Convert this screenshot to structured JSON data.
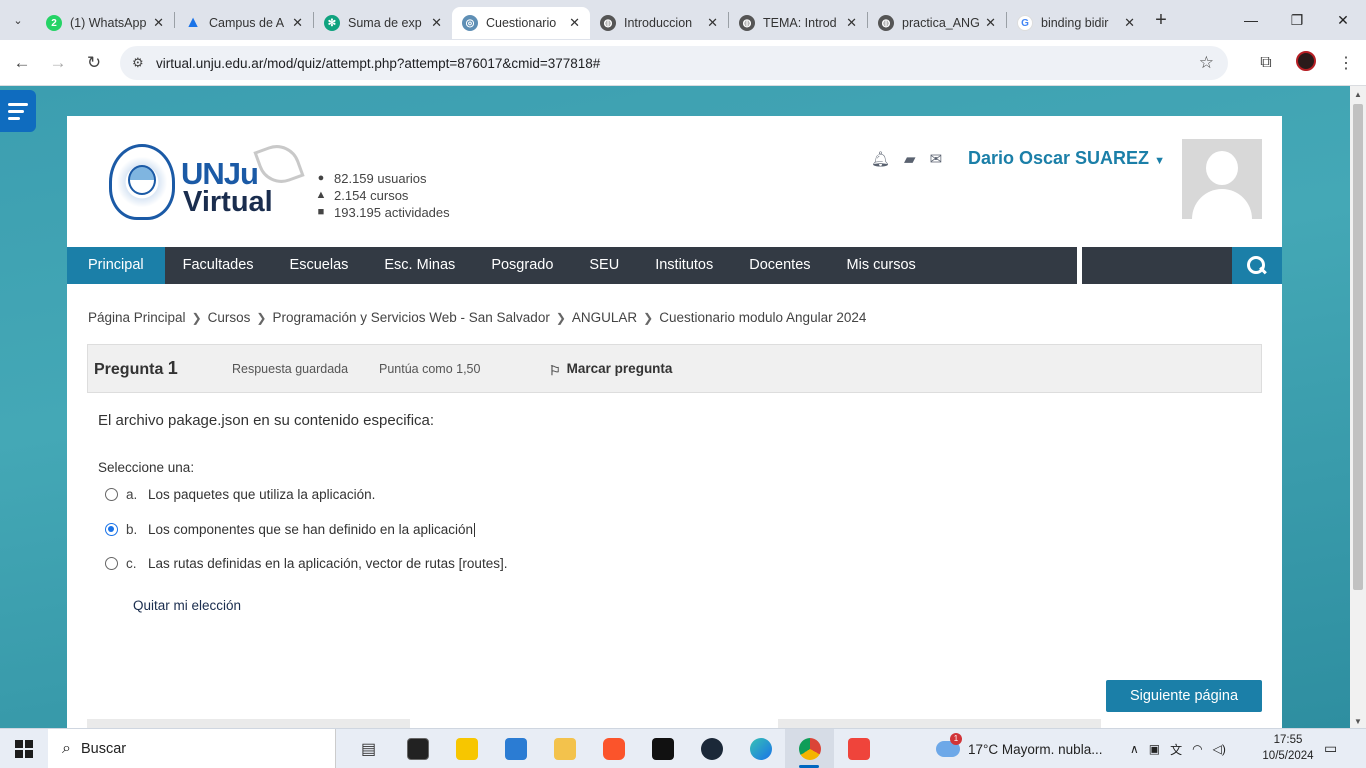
{
  "browser": {
    "tabs": [
      {
        "title": "(1) WhatsApp",
        "icon": "whatsapp-icon",
        "color": "#25d366",
        "active": false
      },
      {
        "title": "Campus de A",
        "icon": "campus-icon",
        "color": "#1a73e8",
        "active": false
      },
      {
        "title": "Suma de exp",
        "icon": "chatgpt-icon",
        "color": "#10a37f",
        "active": false
      },
      {
        "title": "Cuestionario",
        "icon": "moodle-icon",
        "color": "#5f8fb5",
        "active": true
      },
      {
        "title": "Introduccion",
        "icon": "globe-icon",
        "color": "#555555",
        "active": false
      },
      {
        "title": "TEMA: Introd",
        "icon": "globe-icon",
        "color": "#555555",
        "active": false
      },
      {
        "title": "practica_ANG",
        "icon": "globe-icon",
        "color": "#555555",
        "active": false
      },
      {
        "title": "binding bidir",
        "icon": "google-icon",
        "color": "#4285f4",
        "active": false
      }
    ],
    "url": "virtual.unju.edu.ar/mod/quiz/attempt.php?attempt=876017&cmid=377818#"
  },
  "site": {
    "logo_top": "UNJu",
    "logo_bottom": "Virtual",
    "stats": [
      {
        "icon": "user-icon",
        "text": "82.159 usuarios"
      },
      {
        "icon": "graduation-cap-icon",
        "text": "2.154 cursos"
      },
      {
        "icon": "puzzle-icon",
        "text": "193.195 actividades"
      }
    ],
    "username": "Dario Oscar SUAREZ"
  },
  "nav": {
    "items": [
      "Principal",
      "Facultades",
      "Escuelas",
      "Esc. Minas",
      "Posgrado",
      "SEU",
      "Institutos",
      "Docentes",
      "Mis cursos"
    ]
  },
  "breadcrumb": [
    "Página Principal",
    "Cursos",
    "Programación y Servicios Web - San Salvador",
    "ANGULAR",
    "Cuestionario modulo Angular 2024"
  ],
  "question": {
    "label": "Pregunta",
    "number": "1",
    "state": "Respuesta guardada",
    "grade": "Puntúa como 1,50",
    "flag": "Marcar pregunta",
    "text": "El archivo pakage.json en su contenido especifica:",
    "prompt": "Seleccione una:",
    "options": [
      {
        "letter": "a.",
        "text": "Los paquetes que utiliza la aplicación.",
        "selected": false
      },
      {
        "letter": "b.",
        "text": "Los componentes que se han definido en la aplicación",
        "selected": true
      },
      {
        "letter": "c.",
        "text": "Las rutas definidas en la aplicación, vector de rutas [routes].",
        "selected": false
      }
    ],
    "clear": "Quitar mi elección",
    "next": "Siguiente página"
  },
  "taskbar": {
    "search": "Buscar",
    "weather": "17°C  Mayorm. nubla...",
    "weather_badge": "1",
    "time": "17:55",
    "date": "10/5/2024"
  },
  "colors": {
    "brand": "#1b7fa8",
    "navbar": "#333a44",
    "link": "#1a2d4e"
  }
}
